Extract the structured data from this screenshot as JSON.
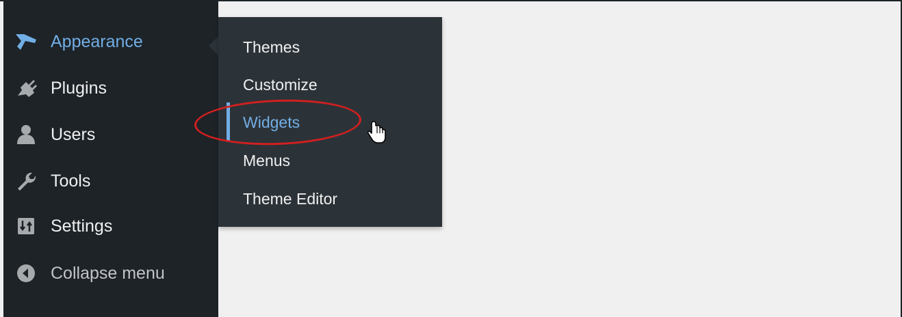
{
  "sidebar": {
    "items": [
      {
        "label": "Appearance",
        "icon": "paintbrush-icon",
        "current": true
      },
      {
        "label": "Plugins",
        "icon": "plugin-icon"
      },
      {
        "label": "Users",
        "icon": "user-icon"
      },
      {
        "label": "Tools",
        "icon": "wrench-icon"
      },
      {
        "label": "Settings",
        "icon": "settings-icon"
      },
      {
        "label": "Collapse menu",
        "icon": "collapse-arrow-icon"
      }
    ]
  },
  "submenu": {
    "items": [
      {
        "label": "Themes"
      },
      {
        "label": "Customize"
      },
      {
        "label": "Widgets",
        "active": true
      },
      {
        "label": "Menus"
      },
      {
        "label": "Theme Editor"
      }
    ]
  },
  "colors": {
    "sidebar_bg": "#1d2327",
    "submenu_bg": "#2c3338",
    "accent": "#72aee6",
    "content_bg": "#f0f0f1",
    "annotation": "#d21f1f"
  }
}
